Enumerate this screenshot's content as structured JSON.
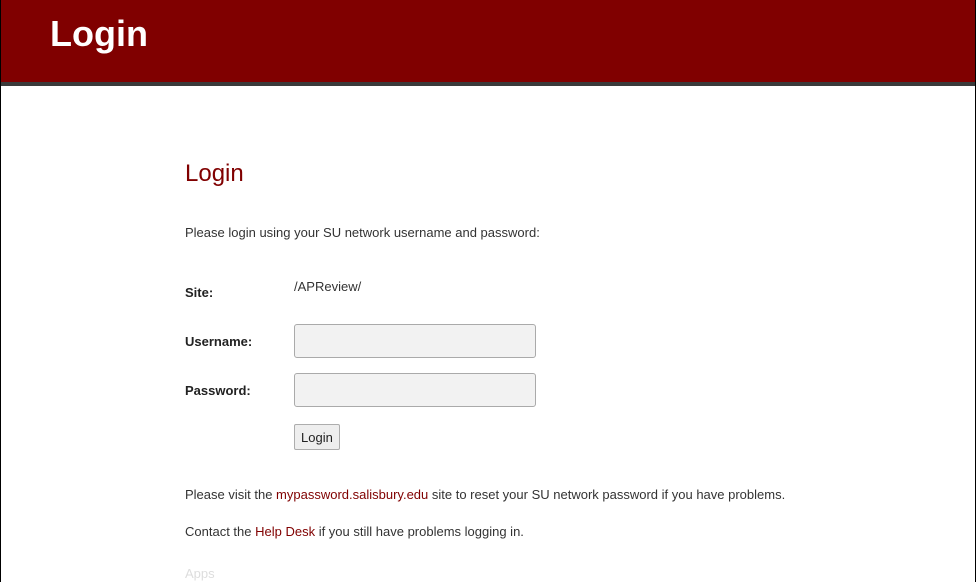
{
  "header": {
    "title": "Login"
  },
  "main": {
    "heading": "Login",
    "intro": "Please login using your SU network username and password:",
    "site": {
      "label": "Site:",
      "value": "/APReview/"
    },
    "username": {
      "label": "Username:",
      "value": "",
      "placeholder": ""
    },
    "password": {
      "label": "Password:",
      "value": "",
      "placeholder": ""
    },
    "login_button": "Login",
    "reset_note": {
      "before": "Please visit the ",
      "link": "mypassword.salisbury.edu",
      "after": " site to reset your SU network password if you have problems."
    },
    "help_note": {
      "before": "Contact the ",
      "link": "Help Desk",
      "after": " if you still have problems logging in."
    },
    "apps_label": "Apps"
  },
  "colors": {
    "brand": "#800000",
    "header_border": "#3a3a3a",
    "text": "#333333",
    "input_bg": "#f2f2f2"
  }
}
